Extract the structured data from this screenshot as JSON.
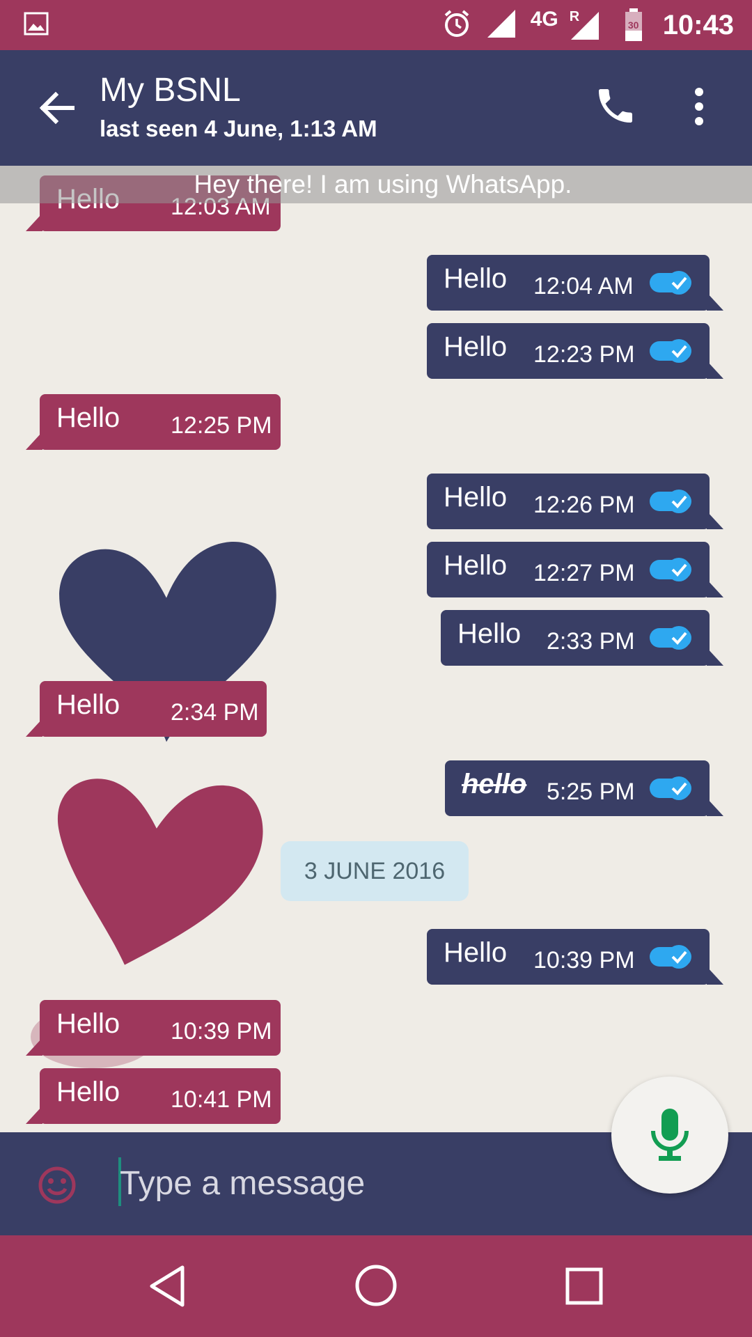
{
  "status_bar": {
    "time": "10:43",
    "network_label": "4G",
    "roaming_label": "R",
    "battery_label": "30"
  },
  "header": {
    "contact_name": "My BSNL",
    "last_seen": "last seen 4 June, 1:13 AM"
  },
  "chat": {
    "status_message": "Hey there! I am using WhatsApp.",
    "date_chip": "3 JUNE 2016",
    "messages": [
      {
        "dir": "in",
        "text": "Hello",
        "time": "12:03 AM"
      },
      {
        "dir": "out",
        "text": "Hello",
        "time": "12:04 AM"
      },
      {
        "dir": "out",
        "text": "Hello",
        "time": "12:23 PM"
      },
      {
        "dir": "in",
        "text": "Hello",
        "time": "12:25 PM"
      },
      {
        "dir": "out",
        "text": "Hello",
        "time": "12:26 PM"
      },
      {
        "dir": "out",
        "text": "Hello",
        "time": "12:27 PM"
      },
      {
        "dir": "out",
        "text": "Hello",
        "time": "2:33 PM"
      },
      {
        "dir": "in",
        "text": "Hello",
        "time": "2:34 PM"
      },
      {
        "dir": "out",
        "text": "hello",
        "time": "5:25 PM"
      },
      {
        "dir": "out",
        "text": "Hello",
        "time": "10:39 PM"
      },
      {
        "dir": "in",
        "text": "Hello",
        "time": "10:39 PM"
      },
      {
        "dir": "in",
        "text": "Hello",
        "time": "10:41 PM"
      }
    ]
  },
  "composer": {
    "placeholder": "Type a message"
  },
  "colors": {
    "brand_pink": "#9e375c",
    "brand_navy": "#393e65",
    "tick_blue": "#2ea8f0",
    "mic_green": "#129d52"
  },
  "icons": [
    "image-icon",
    "alarm-icon",
    "signal-icon",
    "battery-icon",
    "back-arrow-icon",
    "phone-icon",
    "more-vert-icon",
    "read-receipt-icon",
    "emoji-icon",
    "mic-icon",
    "nav-back-icon",
    "nav-home-icon",
    "nav-recents-icon"
  ]
}
